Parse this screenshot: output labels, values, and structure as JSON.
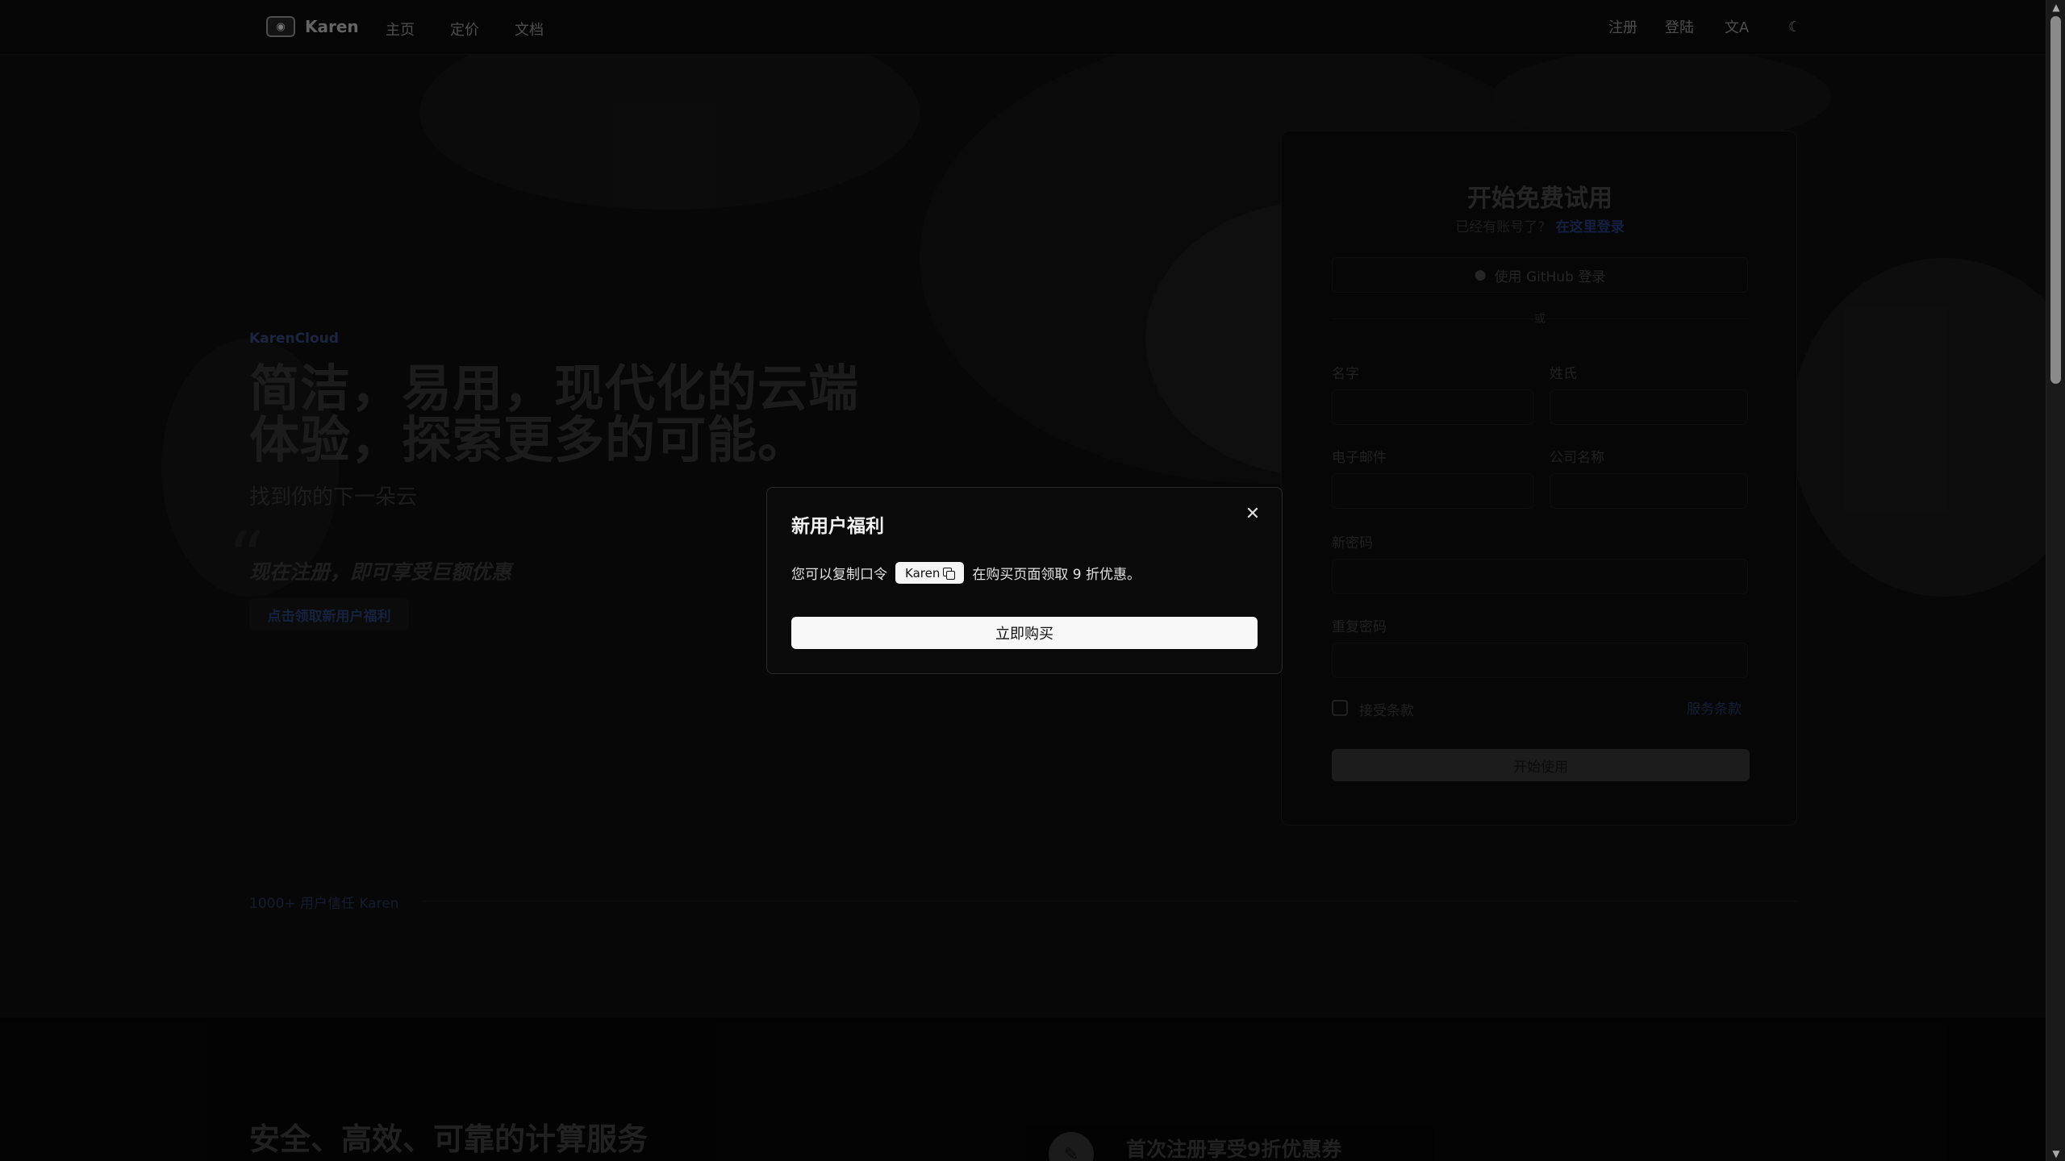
{
  "nav": {
    "brand_name": "Karen",
    "links": [
      "主页",
      "定价",
      "文档"
    ],
    "register": "注册",
    "login": "登陆",
    "translate_icon": "文A",
    "theme_icon": "☾"
  },
  "hero": {
    "kicker": "KarenCloud",
    "title": "简洁，易用，现代化的云端体验，探索更多的可能。",
    "subtitle": "找到你的下一朵云",
    "promo": "现在注册，即可享受巨额优惠",
    "promo_button": "点击领取新用户福利"
  },
  "signup": {
    "title": "开始免费试用",
    "subtitle_prefix": "已经有账号了?",
    "subtitle_link": "在这里登录",
    "github_button": "使用 GitHub 登录",
    "divider": "或",
    "first_name": "名字",
    "last_name": "姓氏",
    "email": "电子邮件",
    "company": "公司名称",
    "new_password": "新密码",
    "repeat_password": "重复密码",
    "accept_terms": "接受条款",
    "terms_link": "服务条款",
    "start_button": "开始使用"
  },
  "trust": {
    "text": "1000+ 用户信任 Karen"
  },
  "lower": {
    "title": "安全、高效、可靠的计算服务",
    "feature": "首次注册享受9折优惠券"
  },
  "modal": {
    "title": "新用户福利",
    "body_prefix": "您可以复制口令",
    "code": "Karen",
    "body_suffix": "在购买页面领取 9 折优惠。",
    "buy_button": "立即购买",
    "close": "✕"
  }
}
